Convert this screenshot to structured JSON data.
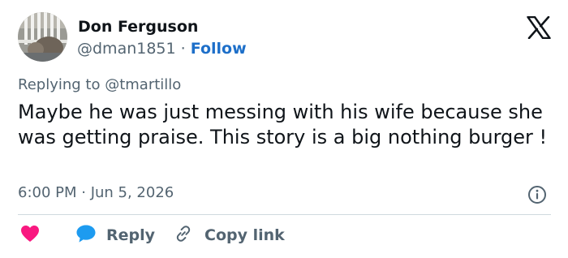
{
  "author": {
    "name": "Don Ferguson",
    "handle": "@dman1851",
    "separator": "·",
    "follow_label": "Follow"
  },
  "reply_context": {
    "prefix": "Replying to",
    "mention": "@tmartillo"
  },
  "tweet": {
    "text": "Maybe he was just messing with his wife because she was getting praise. This story is a big nothing burger !",
    "timestamp": "6:00 PM · Jun 5, 2026"
  },
  "actions": {
    "reply_label": "Reply",
    "copy_link_label": "Copy link"
  },
  "colors": {
    "text_primary": "#0f1419",
    "text_secondary": "#536471",
    "follow_link": "#1d6fc9",
    "heart": "#f91880",
    "reply_bubble": "#1d9bf0",
    "divider": "#cfd9de"
  },
  "icons": {
    "brand": "x-logo-icon",
    "info": "info-icon",
    "like": "heart-icon",
    "reply": "speech-bubble-icon",
    "copy": "link-icon"
  }
}
